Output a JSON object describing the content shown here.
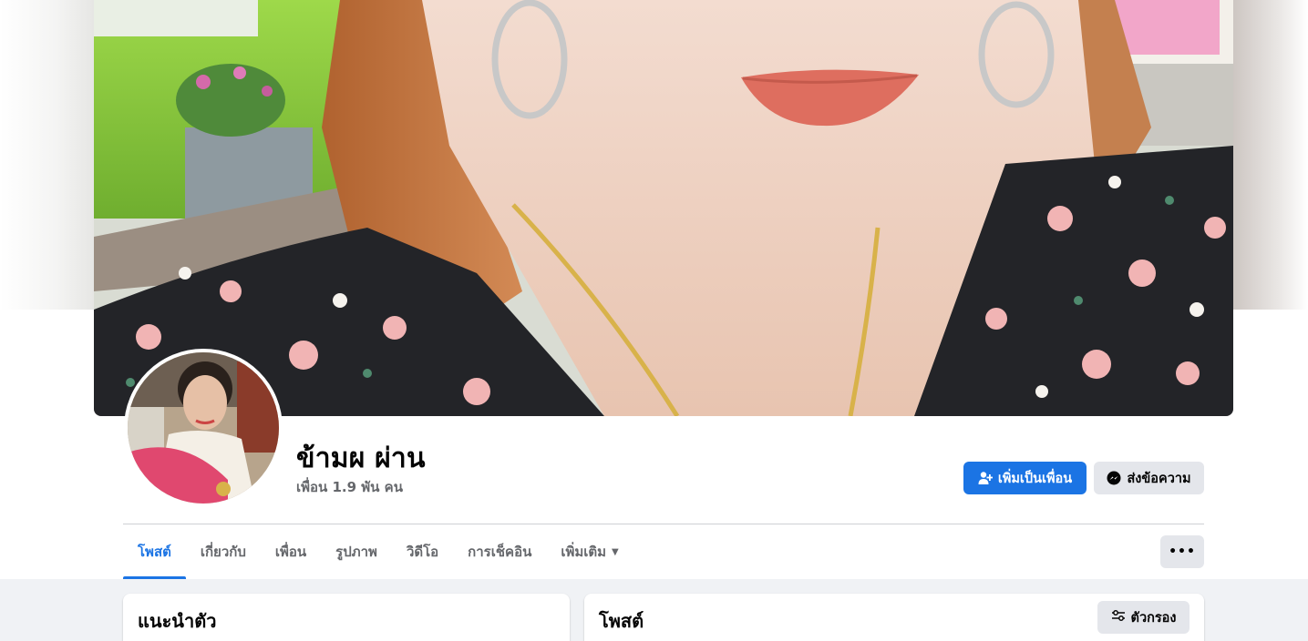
{
  "profile": {
    "name": "ข้ามผ ผ่าน",
    "friends_count": "เพื่อน 1.9 พัน คน"
  },
  "actions": {
    "add_friend_label": "เพิ่มเป็นเพื่อน",
    "message_label": "ส่งข้อความ",
    "more_label": "•••"
  },
  "tabs": [
    {
      "label": "โพสต์",
      "active": true
    },
    {
      "label": "เกี่ยวกับ",
      "active": false
    },
    {
      "label": "เพื่อน",
      "active": false
    },
    {
      "label": "รูปภาพ",
      "active": false
    },
    {
      "label": "วิดีโอ",
      "active": false
    },
    {
      "label": "การเช็คอิน",
      "active": false
    },
    {
      "label": "เพิ่มเติม",
      "active": false
    }
  ],
  "intro": {
    "title": "แนะนำตัว"
  },
  "posts": {
    "title": "โพสต์",
    "filter_label": "ตัวกรอง"
  },
  "icons": {
    "add_friend": "person-add-icon",
    "messenger": "messenger-icon",
    "caret": "caret-down-icon",
    "filter": "sliders-icon"
  },
  "colors": {
    "accent": "#1b74e4",
    "button_gray": "#e4e6eb",
    "page_bg": "#f0f2f5",
    "secondary_text": "#65676b"
  }
}
